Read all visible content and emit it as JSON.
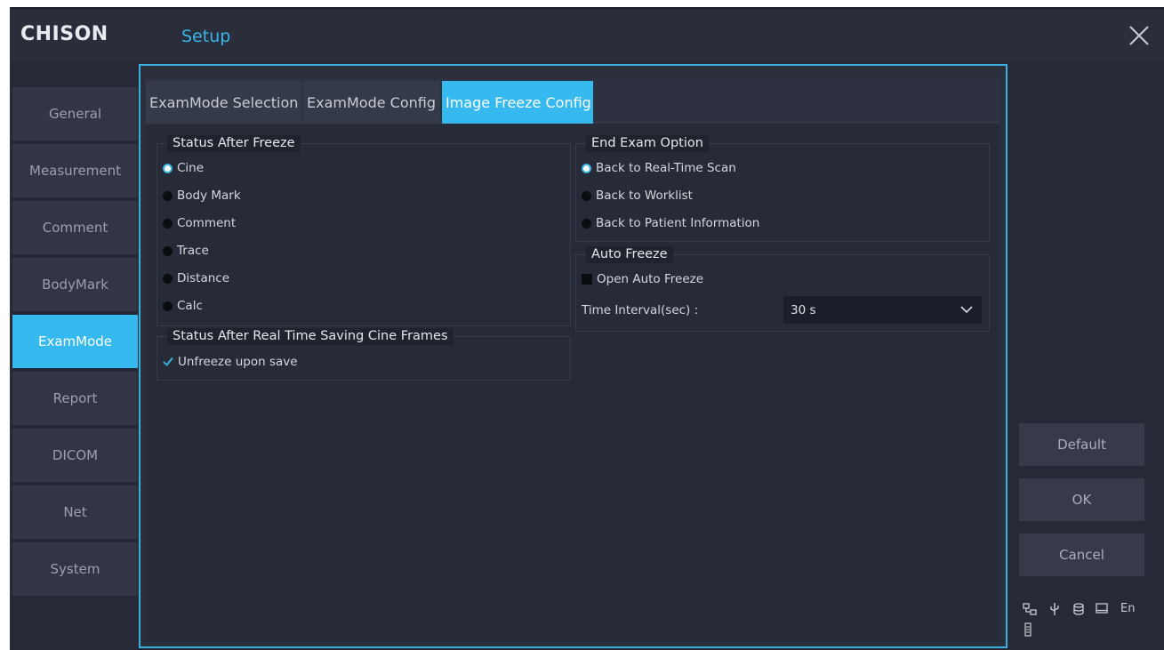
{
  "app": {
    "logo": "CHISON",
    "title": "Setup"
  },
  "sidebar": {
    "items": [
      {
        "label": "General"
      },
      {
        "label": "Measurement"
      },
      {
        "label": "Comment"
      },
      {
        "label": "BodyMark"
      },
      {
        "label": "ExamMode",
        "active": true
      },
      {
        "label": "Report"
      },
      {
        "label": "DICOM"
      },
      {
        "label": "Net"
      },
      {
        "label": "System"
      }
    ]
  },
  "tabs": [
    {
      "label": "ExamMode Selection"
    },
    {
      "label": "ExamMode Config"
    },
    {
      "label": "Image Freeze Config",
      "active": true
    }
  ],
  "status_after_freeze": {
    "title": "Status After Freeze",
    "options": [
      {
        "label": "Cine",
        "selected": true
      },
      {
        "label": "Body Mark",
        "selected": false
      },
      {
        "label": "Comment",
        "selected": false
      },
      {
        "label": "Trace",
        "selected": false
      },
      {
        "label": "Distance",
        "selected": false
      },
      {
        "label": "Calc",
        "selected": false
      }
    ]
  },
  "status_after_saving": {
    "title": "Status After Real Time Saving Cine Frames",
    "checkbox": {
      "label": "Unfreeze upon save",
      "checked": true
    }
  },
  "end_exam_option": {
    "title": "End Exam Option",
    "options": [
      {
        "label": "Back to Real-Time Scan",
        "selected": true
      },
      {
        "label": "Back to Worklist",
        "selected": false
      },
      {
        "label": "Back to Patient Information",
        "selected": false
      }
    ]
  },
  "auto_freeze": {
    "title": "Auto Freeze",
    "checkbox": {
      "label": "Open Auto Freeze",
      "checked": false
    },
    "interval_label": "Time Interval(sec) :",
    "interval_value": "30 s"
  },
  "actions": {
    "default_label": "Default",
    "ok_label": "OK",
    "cancel_label": "Cancel"
  },
  "status_bar": {
    "language": "En"
  },
  "colors": {
    "accent": "#35b9ee",
    "background": "#262a36",
    "panel": "#272b37",
    "button": "#363a49"
  }
}
